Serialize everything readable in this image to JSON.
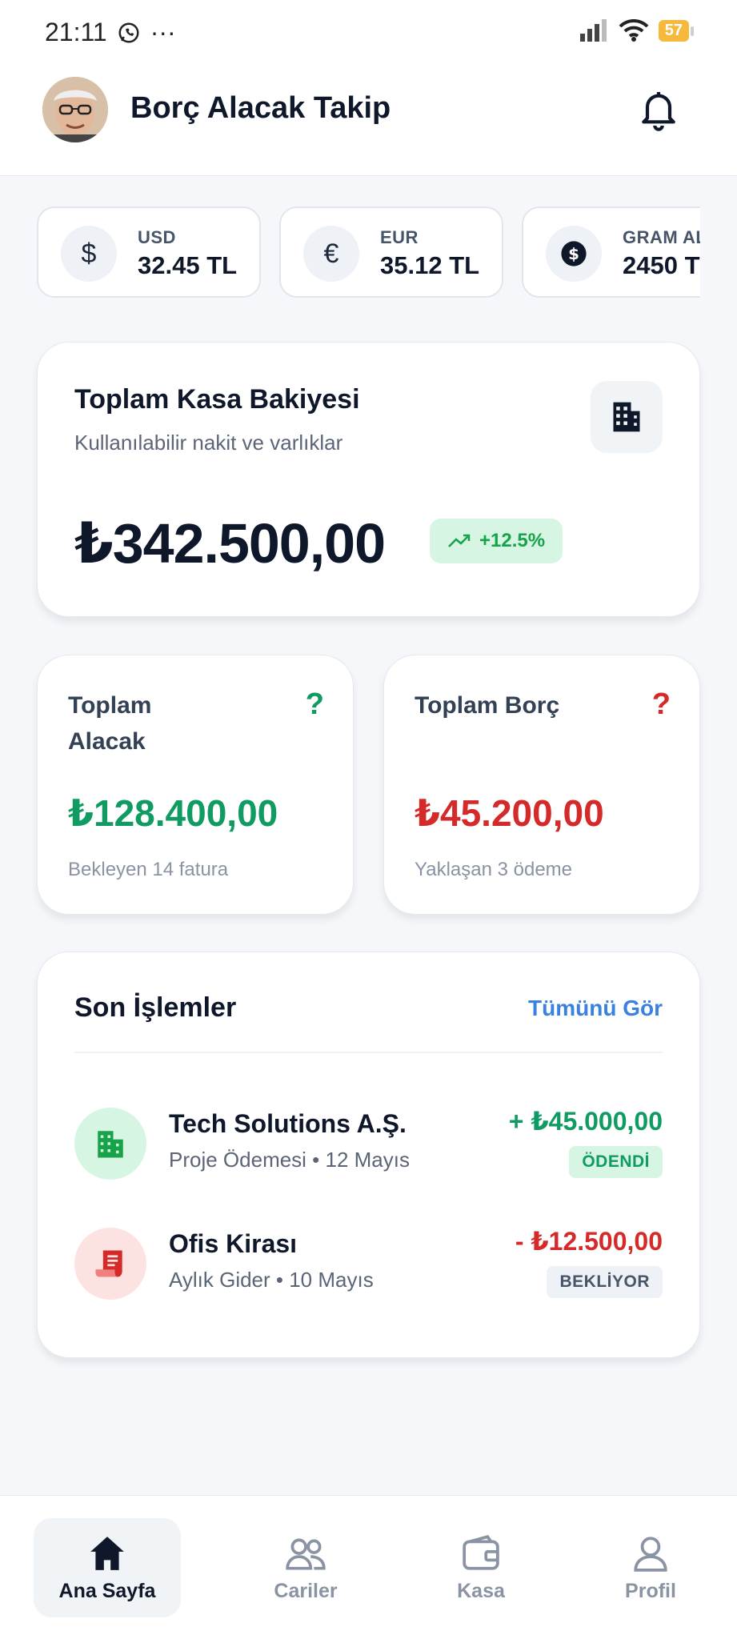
{
  "status_bar": {
    "time": "21:11",
    "dots": "···",
    "battery": "57"
  },
  "header": {
    "title": "Borç Alacak Takip"
  },
  "rates": [
    {
      "symbol": "$",
      "code": "USD",
      "value": "32.45 TL"
    },
    {
      "symbol": "€",
      "code": "EUR",
      "value": "35.12 TL"
    },
    {
      "symbol": "$",
      "code": "GRAM AL",
      "value": "2450 T"
    }
  ],
  "balance": {
    "title": "Toplam Kasa Bakiyesi",
    "subtitle": "Kullanılabilir nakit ve varlıklar",
    "amount": "₺342.500,00",
    "change": "+12.5%"
  },
  "receivable": {
    "title": "Toplam Alacak",
    "icon_glyph": "?",
    "amount": "₺128.400,00",
    "subtitle": "Bekleyen 14 fatura"
  },
  "payable": {
    "title": "Toplam Borç",
    "icon_glyph": "?",
    "amount": "₺45.200,00",
    "subtitle": "Yaklaşan 3 ödeme"
  },
  "transactions": {
    "title": "Son İşlemler",
    "see_all": "Tümünü Gör",
    "items": [
      {
        "name": "Tech Solutions A.Ş.",
        "meta": "Proje Ödemesi • 12 Mayıs",
        "amount": "+ ₺45.000,00",
        "status": "ÖDENDİ",
        "icon": "building-icon"
      },
      {
        "name": "Ofis Kirası",
        "meta": "Aylık Gider • 10 Mayıs",
        "amount": "- ₺12.500,00",
        "status": "BEKLİYOR",
        "icon": "receipt-icon"
      }
    ]
  },
  "nav": [
    {
      "label": "Ana Sayfa",
      "icon": "home-icon",
      "active": true
    },
    {
      "label": "Cariler",
      "icon": "users-icon",
      "active": false
    },
    {
      "label": "Kasa",
      "icon": "wallet-icon",
      "active": false
    },
    {
      "label": "Profil",
      "icon": "user-icon",
      "active": false
    }
  ],
  "colors": {
    "green": "#0f9b61",
    "red": "#d52a2a",
    "accent": "#3b82e0"
  }
}
